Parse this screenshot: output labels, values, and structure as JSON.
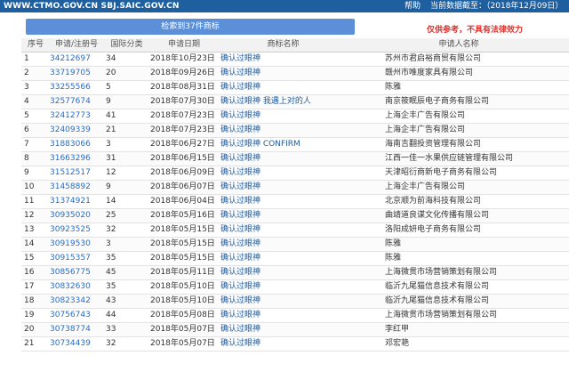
{
  "header": {
    "site": "WWW.CTMO.GOV.CN SBJ.SAIC.GOV.CN",
    "help": "帮助",
    "data_as_of": "当前数据截至：（2018年12月09日）"
  },
  "search": {
    "result_button": "检索到37件商标",
    "disclaimer": "仅供参考，不具有法律效力"
  },
  "table": {
    "columns": [
      "序号",
      "申请/注册号",
      "国际分类",
      "申请日期",
      "商标名称",
      "申请人名称"
    ],
    "rows": [
      {
        "no": "1",
        "reg": "34212697",
        "cls": "34",
        "date": "2018年10月23日",
        "name": "确认过眼神",
        "applicant": "苏州市君启裕商贸有限公司"
      },
      {
        "no": "2",
        "reg": "33719705",
        "cls": "20",
        "date": "2018年09月26日",
        "name": "确认过眼神",
        "applicant": "赣州市唯度家具有限公司"
      },
      {
        "no": "3",
        "reg": "33255566",
        "cls": "5",
        "date": "2018年08月31日",
        "name": "确认过眼神",
        "applicant": "陈雅"
      },
      {
        "no": "4",
        "reg": "32577674",
        "cls": "9",
        "date": "2018年07月30日",
        "name": "确认过眼神 我遇上对的人",
        "applicant": "南京筱眠辰电子商务有限公司"
      },
      {
        "no": "5",
        "reg": "32412773",
        "cls": "41",
        "date": "2018年07月23日",
        "name": "确认过眼神",
        "applicant": "上海企丰广告有限公司"
      },
      {
        "no": "6",
        "reg": "32409339",
        "cls": "21",
        "date": "2018年07月23日",
        "name": "确认过眼神",
        "applicant": "上海企丰广告有限公司"
      },
      {
        "no": "7",
        "reg": "31883066",
        "cls": "3",
        "date": "2018年06月27日",
        "name": "确认过眼神 CONFIRM",
        "applicant": "海南吉翻投资管理有限公司"
      },
      {
        "no": "8",
        "reg": "31663296",
        "cls": "31",
        "date": "2018年06月15日",
        "name": "确认过眼神",
        "applicant": "江西一佳一水果供应链管理有限公司"
      },
      {
        "no": "9",
        "reg": "31512517",
        "cls": "12",
        "date": "2018年06月09日",
        "name": "确认过眼神",
        "applicant": "天津昭衍商新电子商务有限公司"
      },
      {
        "no": "10",
        "reg": "31458892",
        "cls": "9",
        "date": "2018年06月07日",
        "name": "确认过眼神",
        "applicant": "上海企丰广告有限公司"
      },
      {
        "no": "11",
        "reg": "31374921",
        "cls": "14",
        "date": "2018年06月04日",
        "name": "确认过眼神",
        "applicant": "北京顺为前海科技有限公司"
      },
      {
        "no": "12",
        "reg": "30935020",
        "cls": "25",
        "date": "2018年05月16日",
        "name": "确认过眼神",
        "applicant": "曲靖道良谋文化传播有限公司"
      },
      {
        "no": "13",
        "reg": "30923525",
        "cls": "32",
        "date": "2018年05月15日",
        "name": "确认过眼神",
        "applicant": "洛阳成妍电子商务有限公司"
      },
      {
        "no": "14",
        "reg": "30919530",
        "cls": "3",
        "date": "2018年05月15日",
        "name": "确认过眼神",
        "applicant": "陈雅"
      },
      {
        "no": "15",
        "reg": "30915357",
        "cls": "35",
        "date": "2018年05月15日",
        "name": "确认过眼神",
        "applicant": "陈雅"
      },
      {
        "no": "16",
        "reg": "30856775",
        "cls": "45",
        "date": "2018年05月11日",
        "name": "确认过眼神",
        "applicant": "上海微贯市场营销策划有限公司"
      },
      {
        "no": "17",
        "reg": "30832630",
        "cls": "35",
        "date": "2018年05月10日",
        "name": "确认过眼神",
        "applicant": "临沂九尾猫信息技术有限公司"
      },
      {
        "no": "18",
        "reg": "30823342",
        "cls": "43",
        "date": "2018年05月10日",
        "name": "确认过眼神",
        "applicant": "临沂九尾猫信息技术有限公司"
      },
      {
        "no": "19",
        "reg": "30756743",
        "cls": "44",
        "date": "2018年05月08日",
        "name": "确认过眼神",
        "applicant": "上海微贯市场营销策划有限公司"
      },
      {
        "no": "20",
        "reg": "30738774",
        "cls": "33",
        "date": "2018年05月07日",
        "name": "确认过眼神",
        "applicant": "李红甲"
      },
      {
        "no": "21",
        "reg": "30734439",
        "cls": "32",
        "date": "2018年05月07日",
        "name": "确认过眼神",
        "applicant": "邓宏艳"
      }
    ]
  }
}
